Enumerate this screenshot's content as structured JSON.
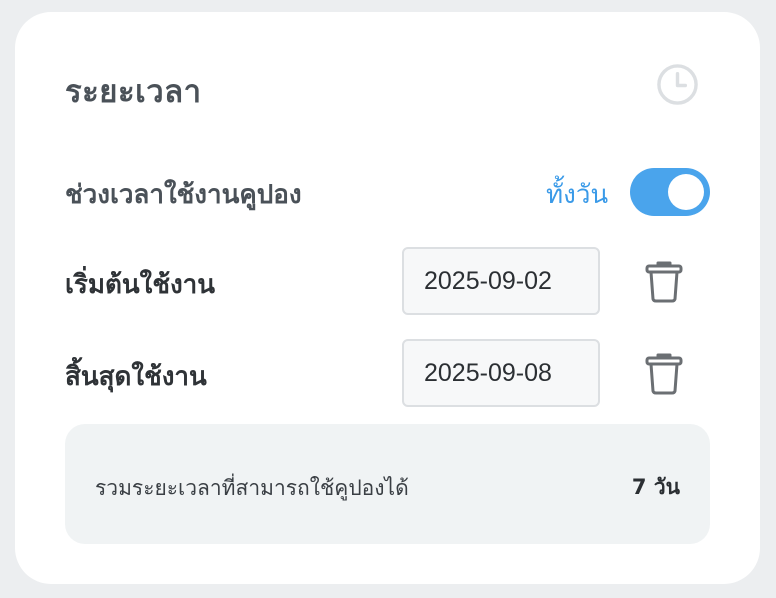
{
  "card": {
    "title": "ระยะเวลา",
    "header_icon": "clock-icon"
  },
  "period": {
    "label": "ช่วงเวลาใช้งานคูปอง",
    "allday_label": "ทั้งวัน",
    "allday_enabled": true,
    "accent_color": "#4aa4ec"
  },
  "start": {
    "label": "เริ่มต้นใช้งาน",
    "value": "2025-09-02",
    "delete_icon": "trash-icon"
  },
  "end": {
    "label": "สิ้นสุดใช้งาน",
    "value": "2025-09-08",
    "delete_icon": "trash-icon"
  },
  "summary": {
    "label": "รวมระยะเวลาที่สามารถใช้คูปองได้",
    "value": "7 วัน"
  }
}
